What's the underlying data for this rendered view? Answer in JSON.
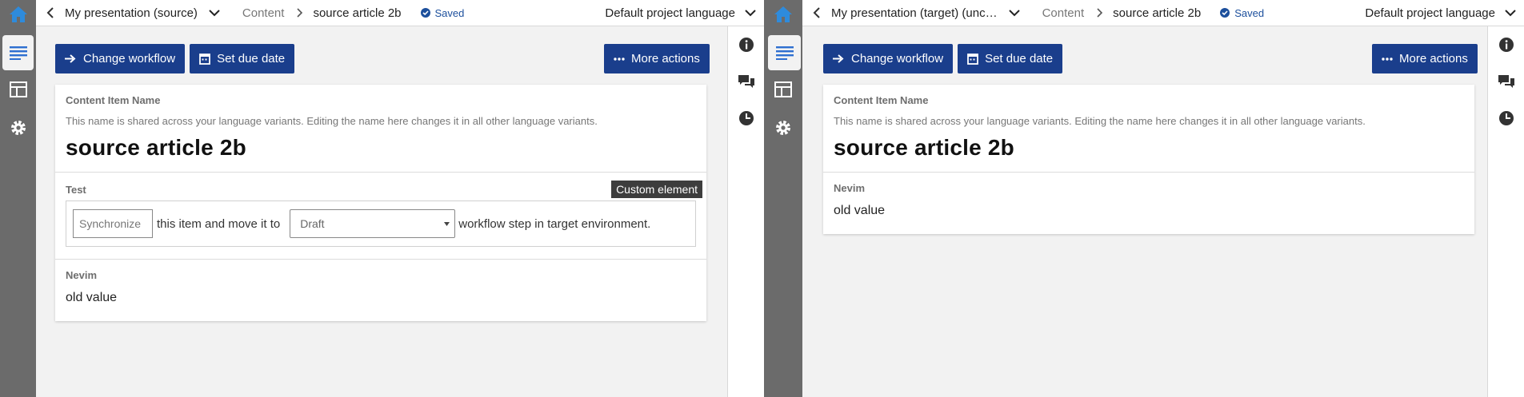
{
  "colors": {
    "primary": "#1a3e8c",
    "home_icon": "#2e8bdc",
    "rail": "#6b6b6b",
    "saved": "#1c4f9c"
  },
  "left": {
    "topbar": {
      "project": "My presentation (source)",
      "section": "Content",
      "item": "source article 2b",
      "status": "Saved",
      "language": "Default project language"
    },
    "toolbar": {
      "change_workflow": "Change workflow",
      "set_due_date": "Set due date",
      "more_actions": "More actions"
    },
    "name_section": {
      "label": "Content Item Name",
      "guidance": "This name is shared across your language variants. Editing the name here changes it in all other language variants.",
      "value": "source article 2b"
    },
    "custom_section": {
      "label": "Test",
      "badge": "Custom element",
      "sync_placeholder": "Synchronize",
      "text_middle": "this item and move it to",
      "select_value": "Draft",
      "text_end": "workflow step in target environment."
    },
    "nevim_section": {
      "label": "Nevim",
      "value": "old value"
    }
  },
  "right": {
    "topbar": {
      "project": "My presentation (target) (unc…",
      "section": "Content",
      "item": "source article 2b",
      "status": "Saved",
      "language": "Default project language"
    },
    "toolbar": {
      "change_workflow": "Change workflow",
      "set_due_date": "Set due date",
      "more_actions": "More actions"
    },
    "name_section": {
      "label": "Content Item Name",
      "guidance": "This name is shared across your language variants. Editing the name here changes it in all other language variants.",
      "value": "source article 2b"
    },
    "nevim_section": {
      "label": "Nevim",
      "value": "old value"
    }
  },
  "icons": [
    "home-icon",
    "content-list-icon",
    "layout-icon",
    "gear-icon",
    "back-chevron-icon",
    "chevron-down-icon",
    "saved-check-icon",
    "arrow-right-icon",
    "calendar-icon",
    "ellipsis-icon",
    "info-icon",
    "comments-icon",
    "clock-icon"
  ]
}
